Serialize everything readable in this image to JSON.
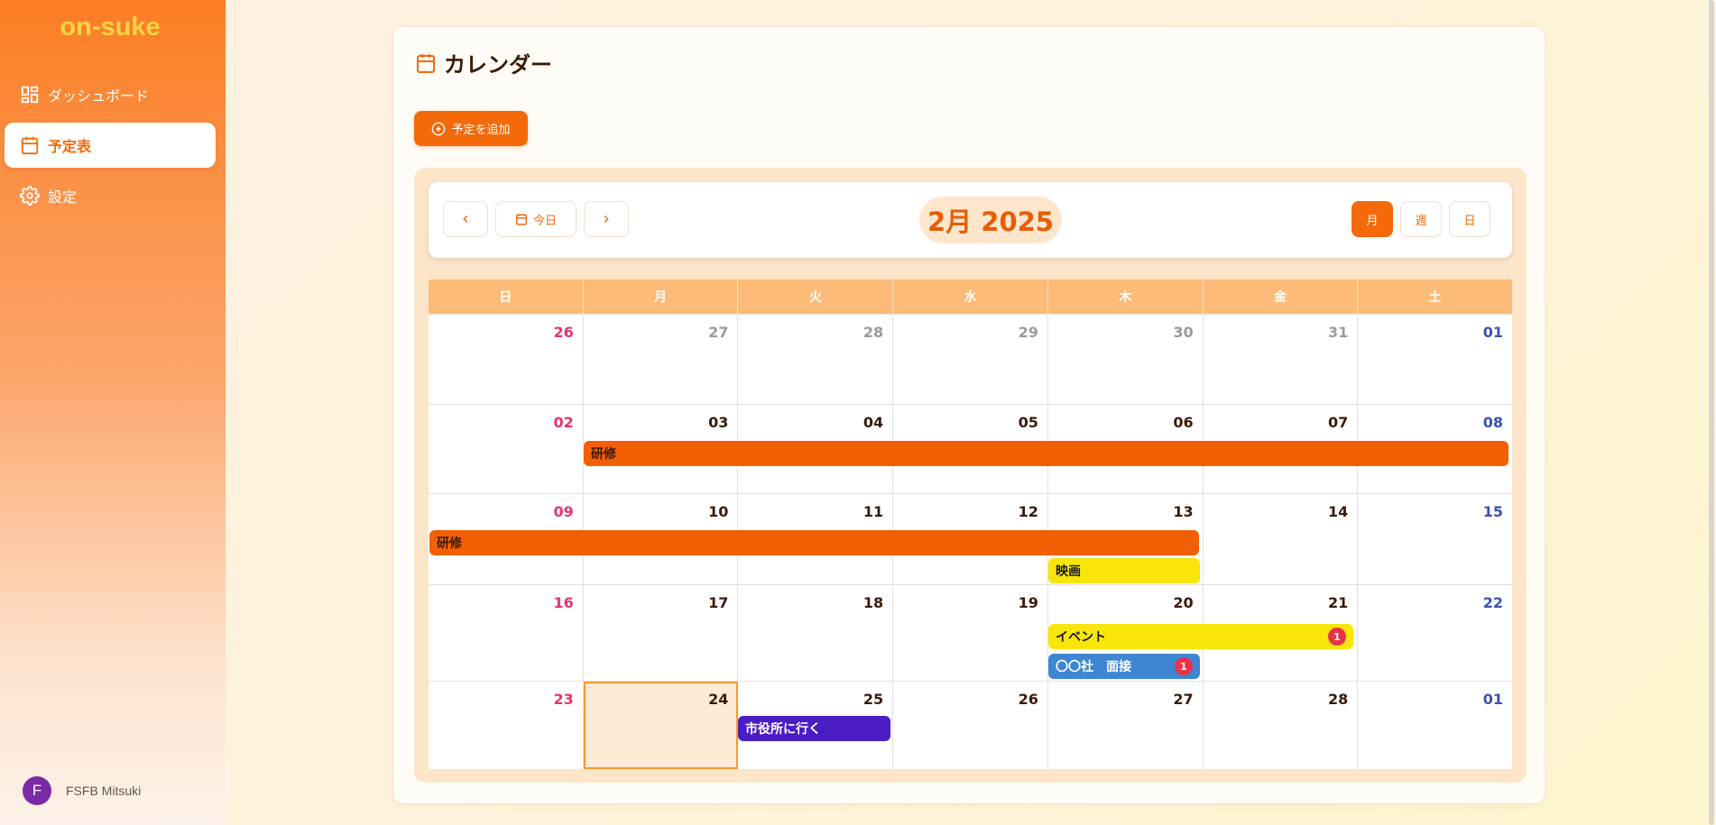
{
  "app": {
    "logo": "on-suke"
  },
  "sidebar": {
    "items": [
      {
        "label": "ダッシュボード",
        "icon": "dashboard-icon"
      },
      {
        "label": "予定表",
        "icon": "calendar-icon",
        "active": true
      },
      {
        "label": "設定",
        "icon": "gear-icon"
      }
    ],
    "user": {
      "initial": "F",
      "name": "FSFB Mitsuki"
    }
  },
  "page": {
    "title": "カレンダー",
    "add_label": "予定を追加"
  },
  "toolbar": {
    "today_label": "今日",
    "month_label": "2月 2025",
    "views": [
      "月",
      "週",
      "日"
    ],
    "active_view": "月"
  },
  "weekdays": [
    "日",
    "月",
    "火",
    "水",
    "木",
    "金",
    "土"
  ],
  "weeks": [
    [
      "26",
      "27",
      "28",
      "29",
      "30",
      "31",
      "01"
    ],
    [
      "02",
      "03",
      "04",
      "05",
      "06",
      "07",
      "08"
    ],
    [
      "09",
      "10",
      "11",
      "12",
      "13",
      "14",
      "15"
    ],
    [
      "16",
      "17",
      "18",
      "19",
      "20",
      "21",
      "22"
    ],
    [
      "23",
      "24",
      "25",
      "26",
      "27",
      "28",
      "01"
    ]
  ],
  "events": [
    {
      "title": "研修",
      "color": "#f25f04"
    },
    {
      "title": "研修",
      "color": "#f25f04"
    },
    {
      "title": "映画",
      "color": "#f8e60a"
    },
    {
      "title": "イベント",
      "color": "#f8e60a",
      "badge": "1"
    },
    {
      "title": "〇〇社　面接",
      "color": "#3d86d4",
      "badge": "1"
    },
    {
      "title": "市役所に行く",
      "color": "#4a1dc4"
    }
  ],
  "colors": {
    "accent": "#f46a0a",
    "sunday": "#e8336a",
    "saturday": "#3c52b0"
  }
}
